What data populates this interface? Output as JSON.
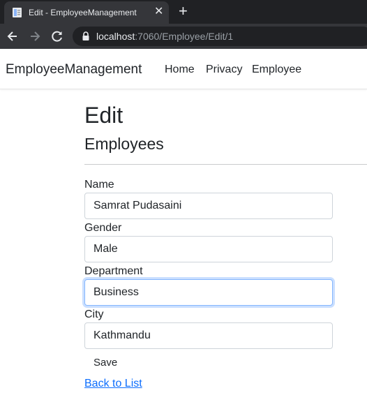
{
  "browser": {
    "tab_title": "Edit - EmployeeManagement",
    "close_glyph": "✕",
    "new_tab_glyph": "+",
    "url_host": "localhost",
    "url_rest": ":7060/Employee/Edit/1"
  },
  "app": {
    "brand": "EmployeeManagement",
    "nav": [
      "Home",
      "Privacy",
      "Employee"
    ]
  },
  "page": {
    "title": "Edit",
    "subtitle": "Employees"
  },
  "form": {
    "name_label": "Name",
    "name_value": "Samrat Pudasaini",
    "gender_label": "Gender",
    "gender_value": "Male",
    "department_label": "Department",
    "department_value": "Business",
    "city_label": "City",
    "city_value": "Kathmandu",
    "save_label": "Save"
  },
  "back_link": "Back to List",
  "colors": {
    "chrome_dark": "#202124",
    "chrome_toolbar": "#35363a",
    "link": "#0d6efd",
    "focus_border": "#86b7fe"
  }
}
